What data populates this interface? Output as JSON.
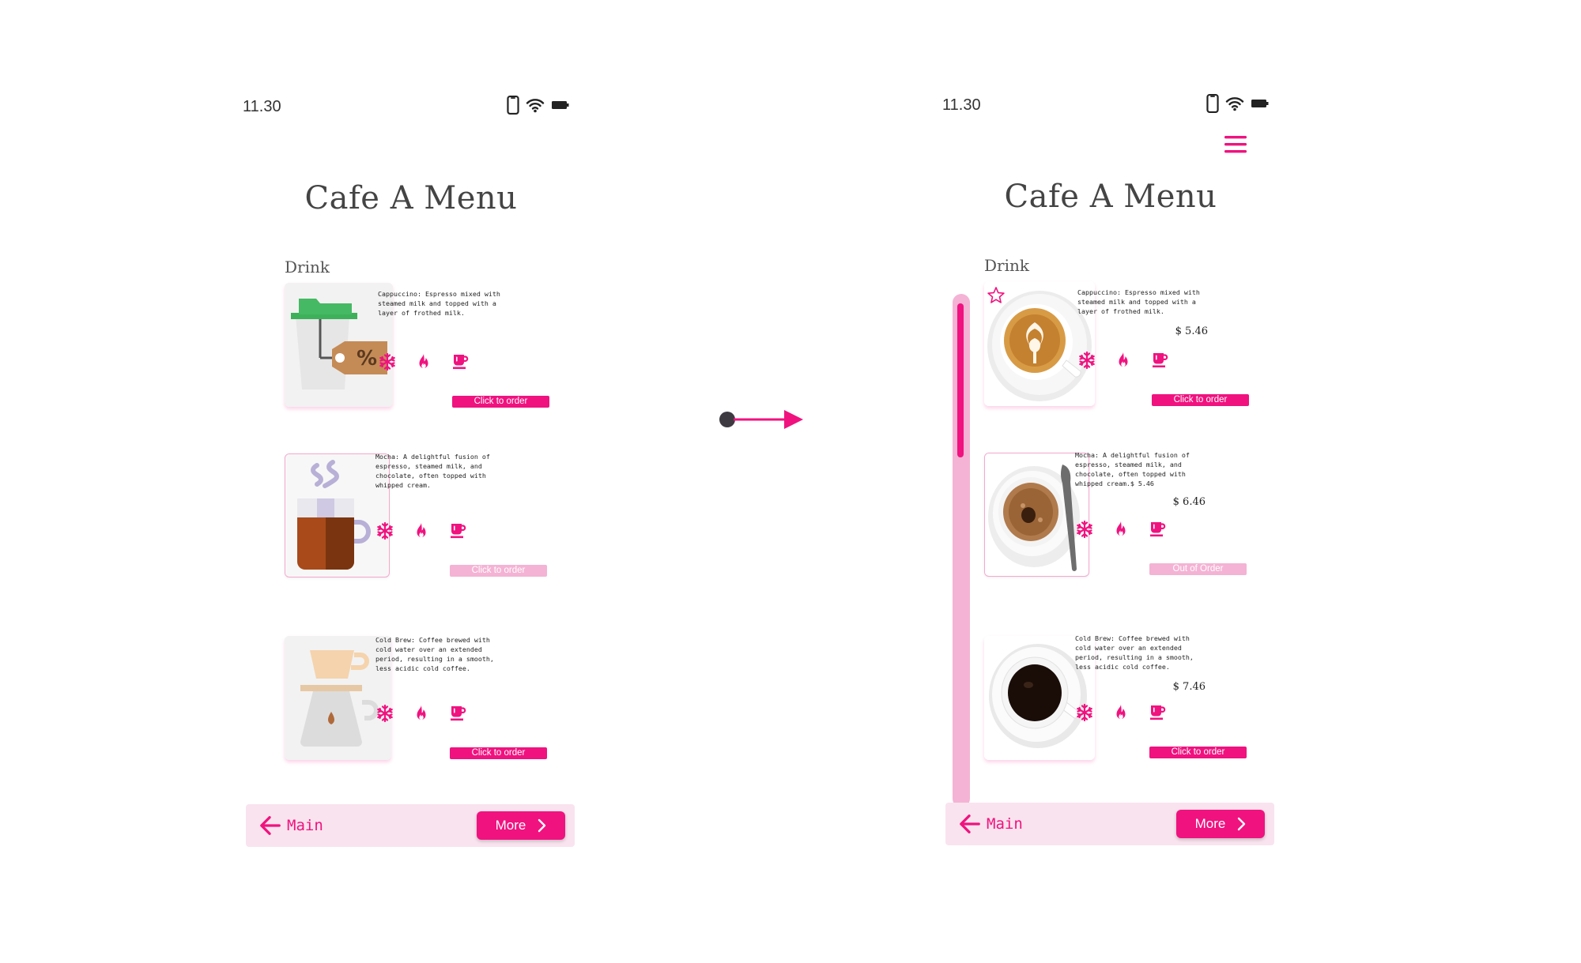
{
  "colors": {
    "accent": "#f0127f",
    "accent_light": "#f4b3d4",
    "bar_bg": "#f9e3ee",
    "arrow_dot": "#3e3a42"
  },
  "before": {
    "status": {
      "time": "11.30",
      "icons": [
        "phone-icon",
        "wifi-icon",
        "battery-icon"
      ]
    },
    "title": "Cafe A Menu",
    "section": "Drink",
    "items": [
      {
        "description": "Cappuccino: Espresso mixed with steamed milk and topped with a layer of frothed milk.",
        "image": "cup-discount-tag-icon",
        "order_label": "Click to order",
        "order_enabled": true
      },
      {
        "description": "Mocha: A delightful fusion of espresso, steamed milk, and chocolate, often topped with whipped cream.",
        "image": "hot-mug-icon",
        "order_label": "Click to order",
        "order_enabled": false
      },
      {
        "description": "Cold Brew: Coffee brewed with cold water over an extended period, resulting in a smooth, less acidic cold coffee.",
        "image": "pour-over-icon",
        "order_label": "Click to order",
        "order_enabled": true
      }
    ],
    "feature_icons": [
      "snowflake-icon",
      "flame-icon",
      "coffee-cup-icon"
    ],
    "nav": {
      "back_label": "Main",
      "more_label": "More"
    }
  },
  "after": {
    "status": {
      "time": "11.30",
      "icons": [
        "phone-icon",
        "wifi-icon",
        "battery-icon"
      ]
    },
    "title": "Cafe A Menu",
    "section": "Drink",
    "scroll_position": 0.2,
    "items": [
      {
        "description": "Cappuccino: Espresso mixed with steamed milk and topped with a layer of frothed milk.",
        "price": "$ 5.46",
        "image": "cappuccino-photo",
        "favorite_icon": "star-outline-icon",
        "order_label": "Click to order",
        "order_enabled": true
      },
      {
        "description": "Mocha: A delightful fusion of espresso, steamed milk, and chocolate, often topped with whipped cream.$ 5.46",
        "price": "$ 6.46",
        "image": "mocha-photo",
        "order_label": "Out of Order",
        "order_enabled": false
      },
      {
        "description": "Cold Brew: Coffee brewed with cold water over an extended period, resulting in a smooth, less acidic cold coffee.",
        "price": "$ 7.46",
        "image": "black-coffee-photo",
        "order_label": "Click to order",
        "order_enabled": true
      }
    ],
    "feature_icons": [
      "snowflake-icon",
      "flame-icon",
      "coffee-cup-icon"
    ],
    "nav": {
      "back_label": "Main",
      "more_label": "More"
    },
    "menu_icon": "hamburger-menu-icon"
  },
  "transition_icon": "right-arrow-icon"
}
